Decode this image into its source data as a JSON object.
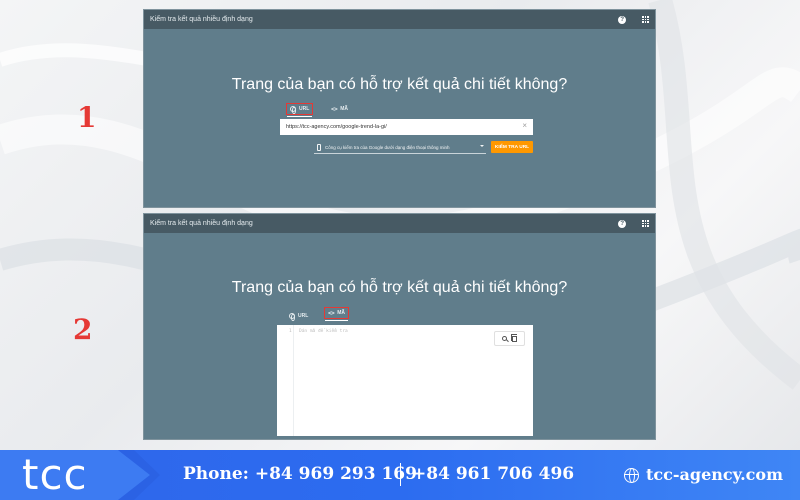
{
  "steps": {
    "first": "1",
    "second": "2"
  },
  "panel1": {
    "title": "Kiểm tra kết quả nhiều định dạng",
    "headline": "Trang của bạn có hỗ trợ kết quả chi tiết không?",
    "tabs": {
      "url": "URL",
      "code": "MÃ"
    },
    "url_value": "https://tcc-agency.com/google-trend-la-gi/",
    "agent_option": "Công cụ kiểm tra của Google dưới dạng điện thoại thông minh",
    "test_button": "KIỂM TRA URL"
  },
  "panel2": {
    "title": "Kiểm tra kết quả nhiều định dạng",
    "headline": "Trang của bạn có hỗ trợ kết quả chi tiết không?",
    "tabs": {
      "url": "URL",
      "code": "MÃ"
    },
    "line_number": "1",
    "code_placeholder": "Dán mã để kiểm tra"
  },
  "footer": {
    "brand": "tcc",
    "phone1": "Phone: +84 969 293 169",
    "phone2": "+84 961 706 496",
    "website": "tcc-agency.com"
  },
  "colors": {
    "panel_bg": "#607d8b",
    "panel_bar": "#475a64",
    "highlight": "#e53935",
    "test_button": "#ff9800",
    "footer": "#2f66ea"
  },
  "icons": [
    "help-icon",
    "apps-grid-icon",
    "globe-icon",
    "code-icon",
    "close-icon",
    "smartphone-icon",
    "dropdown-icon",
    "search-icon",
    "copy-icon"
  ]
}
